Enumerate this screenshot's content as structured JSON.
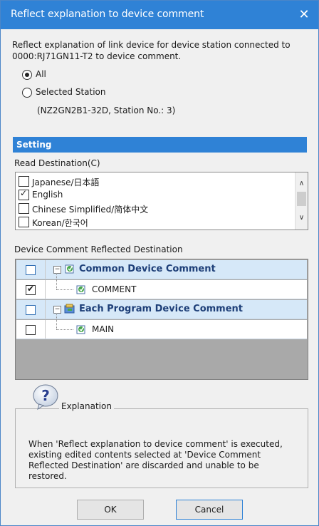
{
  "window": {
    "title": "Reflect explanation to device comment",
    "close_symbol": "✕"
  },
  "description": "Reflect explanation of link device for device station connected to 0000:RJ71GN11-T2 to device comment.",
  "scope": {
    "options": [
      {
        "label": "All",
        "selected": true
      },
      {
        "label": "Selected Station",
        "selected": false
      }
    ],
    "station_detail": "(NZ2GN2B1-32D, Station No.: 3)"
  },
  "setting": {
    "header": "Setting",
    "read_destination_label": "Read Destination(C)",
    "languages": [
      {
        "label": "Japanese/日本語",
        "checked": false
      },
      {
        "label": "English",
        "checked": true
      },
      {
        "label": "Chinese Simplified/简体中文",
        "checked": false
      },
      {
        "label": "Korean/한국어",
        "checked": false
      }
    ]
  },
  "reflected_destination": {
    "label": "Device Comment Reflected Destination",
    "rows": [
      {
        "label": "Common Device Comment",
        "checked": false,
        "group": true
      },
      {
        "label": "COMMENT",
        "checked": true,
        "group": false
      },
      {
        "label": "Each Program Device Comment",
        "checked": false,
        "group": true
      },
      {
        "label": "MAIN",
        "checked": false,
        "group": false
      }
    ]
  },
  "explanation": {
    "legend": "Explanation",
    "text": "When 'Reflect explanation to device comment' is executed, existing edited contents selected at 'Device Comment Reflected Destination' are discarded and unable to be restored."
  },
  "buttons": {
    "ok": "OK",
    "cancel": "Cancel"
  },
  "colors": {
    "accent": "#2f82d6",
    "group_row": "#d6e8f8",
    "grid_bg": "#a9a9a9"
  },
  "icons": [
    "close-icon",
    "expand-collapse-icon",
    "device-comment-icon",
    "program-comment-icon",
    "question-icon",
    "scroll-up-icon",
    "scroll-down-icon"
  ]
}
